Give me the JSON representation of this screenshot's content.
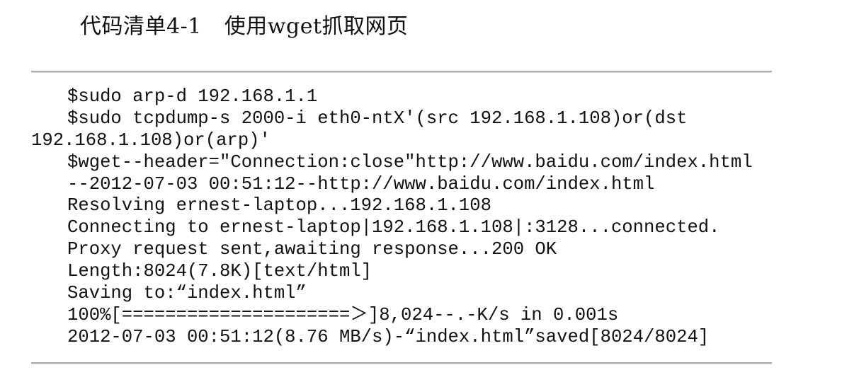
{
  "listing": {
    "label": "代码清单4-1",
    "caption": "使用wget抓取网页"
  },
  "code_lines": [
    {
      "text": "$sudo arp-d 192.168.1.1",
      "indent": true
    },
    {
      "text": "$sudo tcpdump-s 2000-i eth0-ntX'(src 192.168.1.108)or(dst",
      "indent": true
    },
    {
      "text": "192.168.1.108)or(arp)'",
      "indent": false
    },
    {
      "text": "$wget--header=\"Connection:close\"http://www.baidu.com/index.html",
      "indent": true
    },
    {
      "text": "--2012-07-03 00:51:12--http://www.baidu.com/index.html",
      "indent": true
    },
    {
      "text": "Resolving ernest-laptop...192.168.1.108",
      "indent": true
    },
    {
      "text": "Connecting to ernest-laptop|192.168.1.108|:3128...connected.",
      "indent": true
    },
    {
      "text": "Proxy request sent,awaiting response...200 OK",
      "indent": true
    },
    {
      "text": "Length:8024(7.8K)[text/html]",
      "indent": true
    },
    {
      "text": "Saving to:“index.html”",
      "indent": true
    },
    {
      "text": "100%[=====================＞]8,024--.-K/s in 0.001s",
      "indent": true
    },
    {
      "text": "2012-07-03 00:51:12(8.76 MB/s)-“index.html”saved[8024/8024]",
      "indent": true
    }
  ]
}
